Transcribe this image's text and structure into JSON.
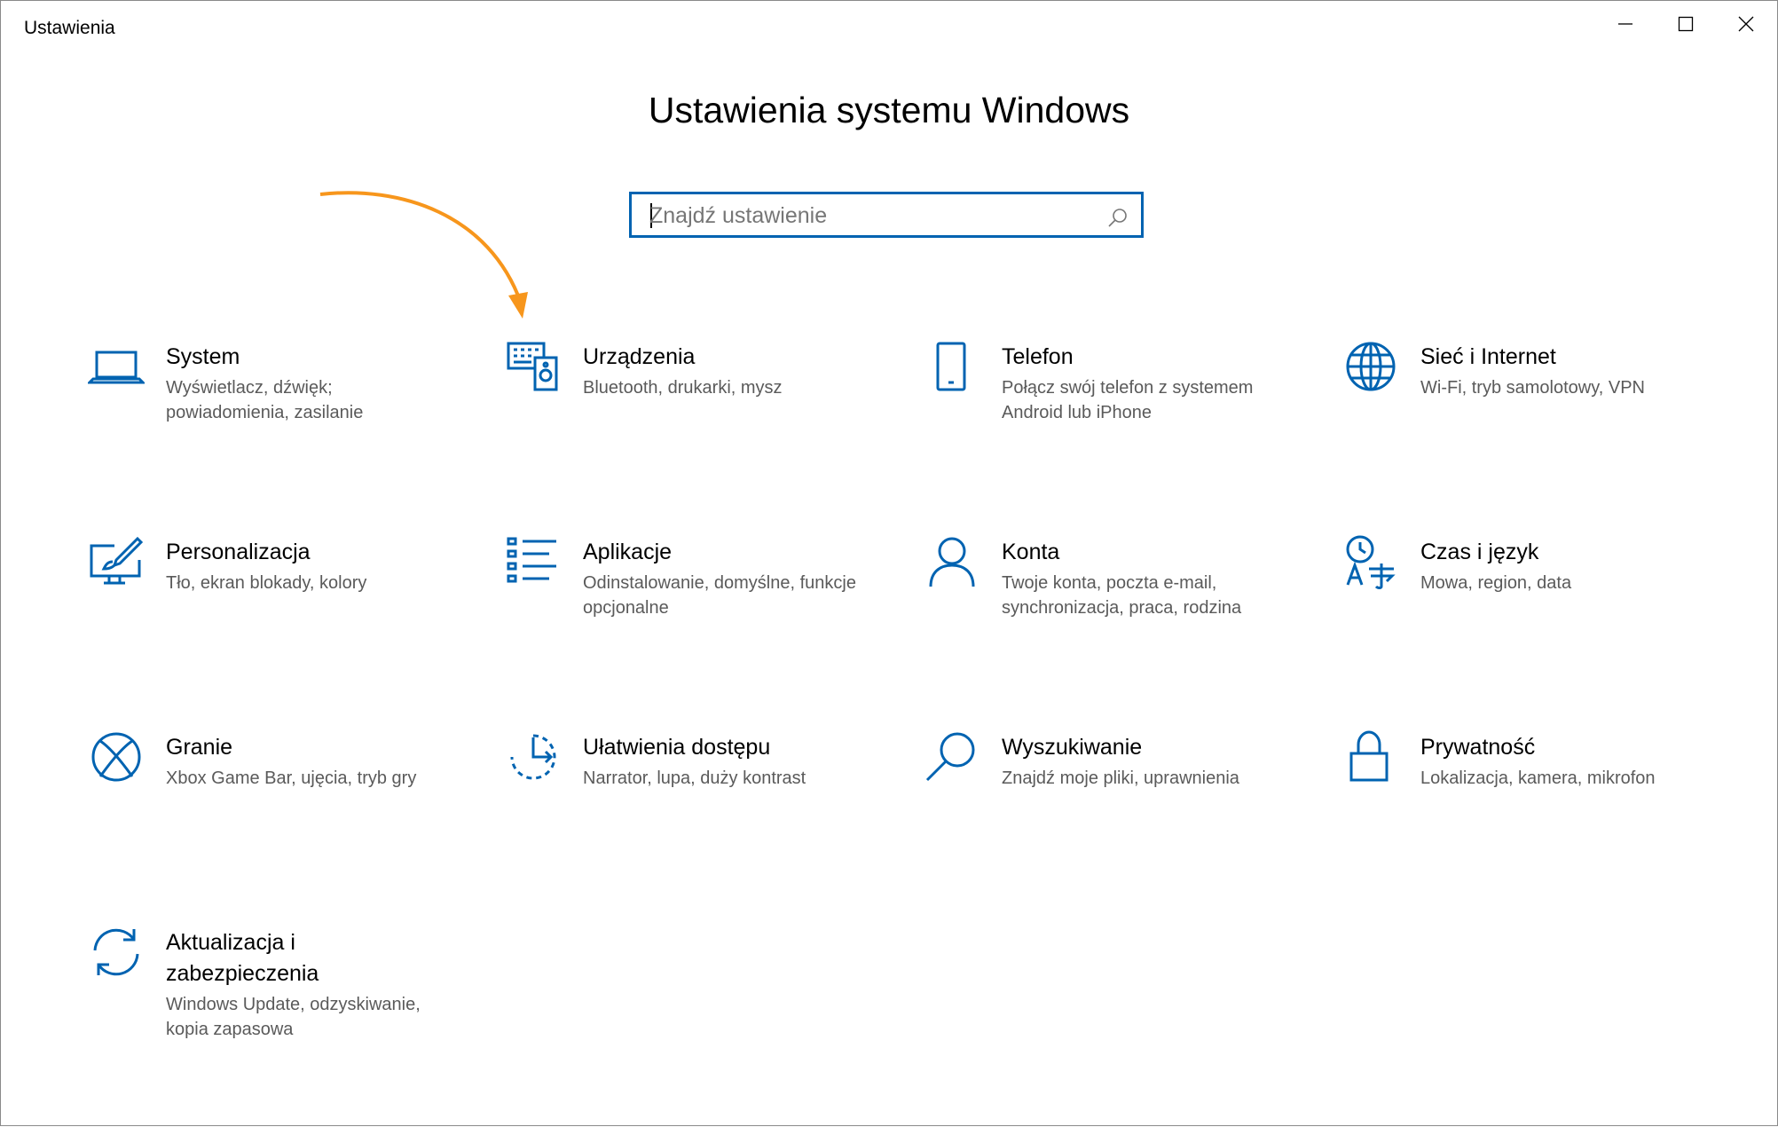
{
  "window": {
    "title": "Ustawienia"
  },
  "page": {
    "title": "Ustawienia systemu Windows"
  },
  "search": {
    "placeholder": "Znajdź ustawienie"
  },
  "colors": {
    "accent": "#0063b1",
    "arrow": "#f7961c"
  },
  "tiles": [
    {
      "name": "System",
      "desc": "Wyświetlacz, dźwięk; powiadomienia, zasilanie",
      "icon": "laptop-icon"
    },
    {
      "name": "Urządzenia",
      "desc": "Bluetooth, drukarki, mysz",
      "icon": "devices-icon"
    },
    {
      "name": "Telefon",
      "desc": "Połącz swój telefon z systemem Android lub iPhone",
      "icon": "phone-icon"
    },
    {
      "name": "Sieć i Internet",
      "desc": "Wi-Fi, tryb samolotowy, VPN",
      "icon": "globe-icon"
    },
    {
      "name": "Personalizacja",
      "desc": "Tło, ekran blokady, kolory",
      "icon": "personalization-icon"
    },
    {
      "name": "Aplikacje",
      "desc": "Odinstalowanie, domyślne, funkcje opcjonalne",
      "icon": "apps-list-icon"
    },
    {
      "name": "Konta",
      "desc": "Twoje konta, poczta e-mail, synchronizacja, praca, rodzina",
      "icon": "person-icon"
    },
    {
      "name": "Czas i język",
      "desc": "Mowa, region, data",
      "icon": "time-language-icon"
    },
    {
      "name": "Granie",
      "desc": "Xbox Game Bar, ujęcia, tryb gry",
      "icon": "xbox-icon"
    },
    {
      "name": "Ułatwienia dostępu",
      "desc": "Narrator, lupa, duży kontrast",
      "icon": "ease-of-access-icon"
    },
    {
      "name": "Wyszukiwanie",
      "desc": "Znajdź moje pliki, uprawnienia",
      "icon": "magnifier-icon"
    },
    {
      "name": "Prywatność",
      "desc": "Lokalizacja, kamera, mikrofon",
      "icon": "lock-icon"
    },
    {
      "name": "Aktualizacja i zabezpieczenia",
      "desc": "Windows Update, odzyskiwanie, kopia zapasowa",
      "icon": "update-icon"
    }
  ]
}
